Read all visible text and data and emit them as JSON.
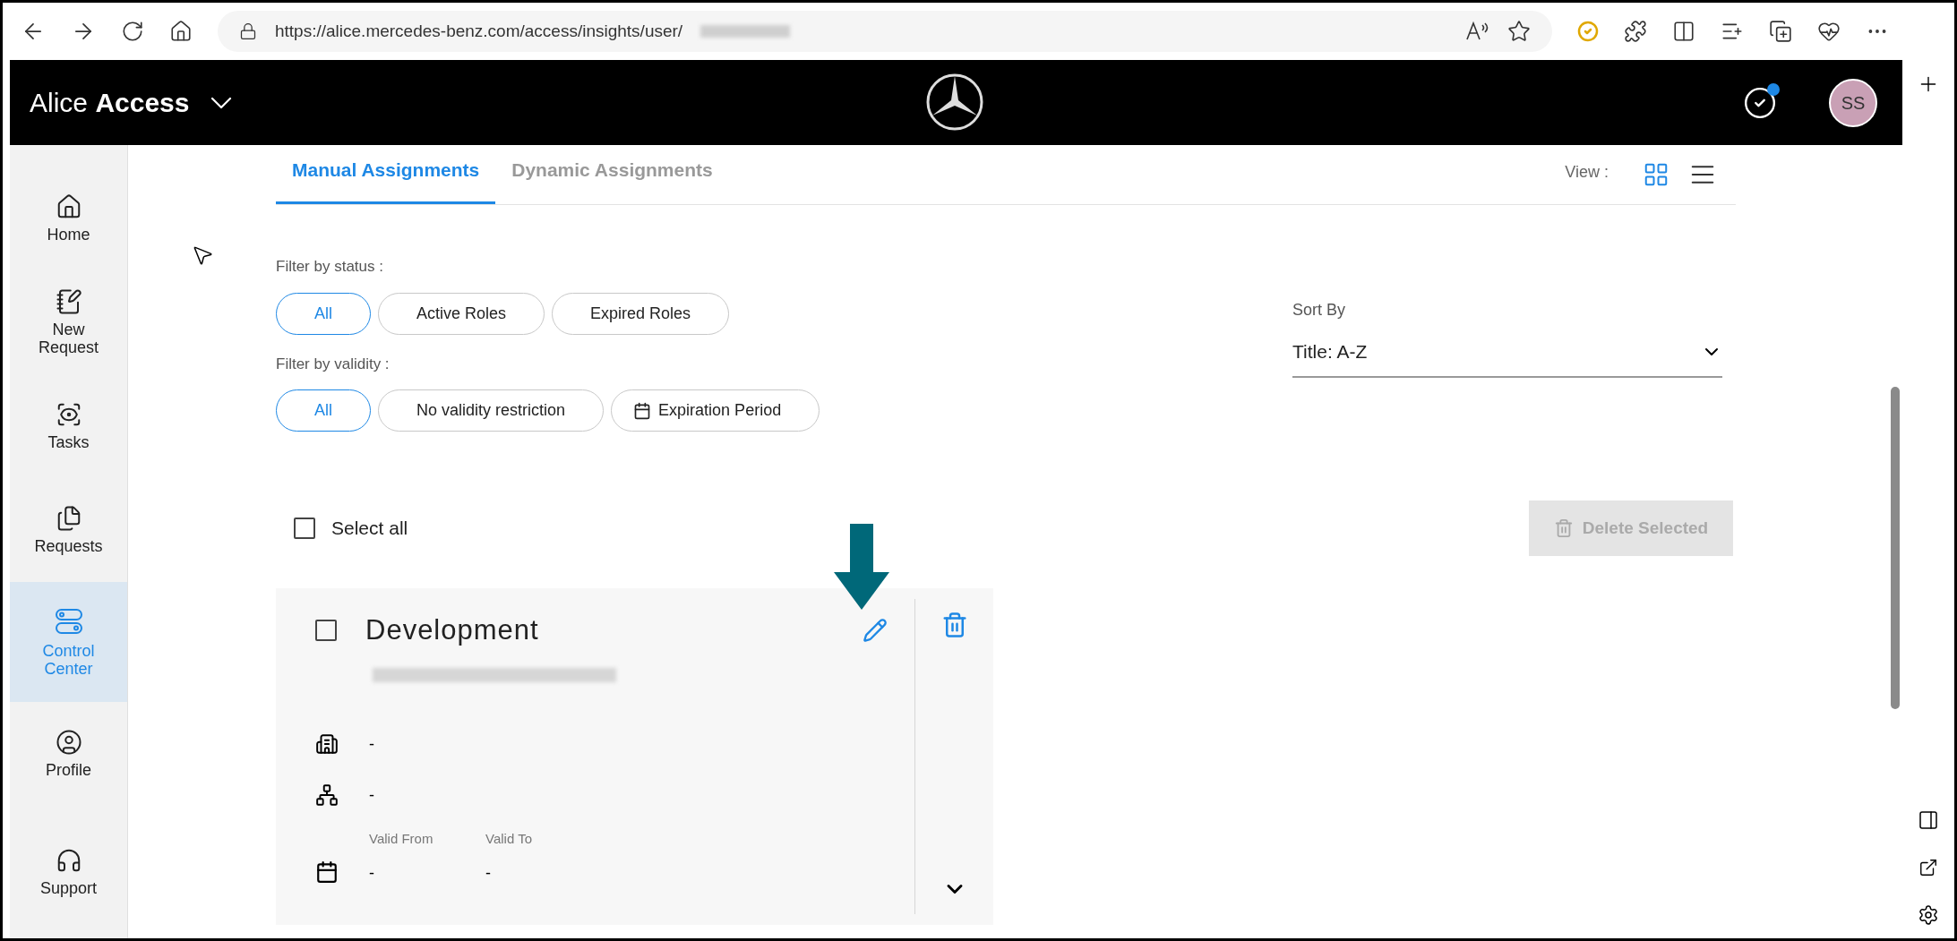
{
  "browser": {
    "url": "https://alice.mercedes-benz.com/access/insights/user/"
  },
  "header": {
    "title": "Alice",
    "title_bold": "Access",
    "notification": true,
    "avatar": "SS"
  },
  "sidebar": {
    "items": [
      {
        "label": "Home",
        "kind": "home",
        "selected": false
      },
      {
        "label": "New\nRequest",
        "kind": "request",
        "selected": false
      },
      {
        "label": "Tasks",
        "kind": "tasks",
        "selected": false
      },
      {
        "label": "Requests",
        "kind": "requests",
        "selected": false
      },
      {
        "label": "Control\nCenter",
        "kind": "control",
        "selected": true
      },
      {
        "label": "Profile",
        "kind": "profile",
        "selected": false
      },
      {
        "label": "Support",
        "kind": "support",
        "selected": false
      }
    ]
  },
  "tabs": [
    {
      "label": "Manual Assignments",
      "selected": true
    },
    {
      "label": "Dynamic Assignments",
      "selected": false
    }
  ],
  "view": {
    "label": "View :",
    "options": [
      {
        "kind": "grid",
        "selected": true
      },
      {
        "kind": "list",
        "selected": false
      }
    ]
  },
  "filters": [
    {
      "label": "Filter by status :",
      "options": [
        {
          "label": "All",
          "selected": true
        },
        {
          "label": "Active Roles",
          "selected": false
        },
        {
          "label": "Expired Roles",
          "selected": false
        }
      ]
    },
    {
      "label": "Filter by validity :",
      "options": [
        {
          "label": "All",
          "selected": true
        },
        {
          "label": "No validity restriction",
          "selected": false
        },
        {
          "label": "Expiration Period",
          "selected": false,
          "kind": "calendar"
        }
      ]
    }
  ],
  "sort": {
    "label": "Sort By",
    "value": "Title: A-Z"
  },
  "select_all": {
    "label": "Select all",
    "checked": false
  },
  "delete_selected": {
    "label": "Delete Selected",
    "disabled": true
  },
  "card": {
    "title": "Development",
    "checked": false,
    "subtitle_redacted": true,
    "fields": [
      {
        "kind": "organization",
        "value": "-"
      },
      {
        "kind": "structure",
        "value": "-"
      }
    ],
    "validity": {
      "from_label": "Valid From",
      "from": "-",
      "to_label": "Valid To",
      "to": "-"
    }
  }
}
